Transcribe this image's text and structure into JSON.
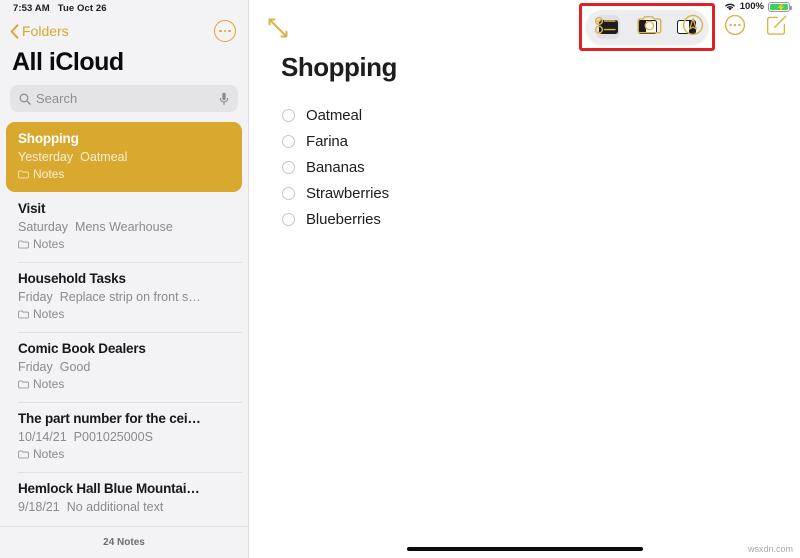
{
  "status_bar": {
    "time": "7:53 AM",
    "date": "Tue Oct 26",
    "wifi_icon": "wifi-icon",
    "battery_percent": "100%",
    "battery_state": "charging"
  },
  "sidebar": {
    "back_label": "Folders",
    "back_icon": "chevron-left-icon",
    "more_icon": "ellipsis-circle-icon",
    "title": "All iCloud",
    "search": {
      "placeholder": "Search",
      "search_icon": "magnifier-icon",
      "dictate_icon": "microphone-icon"
    },
    "notes": [
      {
        "title": "Shopping",
        "date": "Yesterday",
        "preview": "Oatmeal",
        "folder": "Notes",
        "selected": true
      },
      {
        "title": "Visit",
        "date": "Saturday",
        "preview": "Mens Wearhouse",
        "folder": "Notes",
        "selected": false
      },
      {
        "title": "Household Tasks",
        "date": "Friday",
        "preview": "Replace strip on front s…",
        "folder": "Notes",
        "selected": false
      },
      {
        "title": "Comic Book Dealers",
        "date": "Friday",
        "preview": "Good",
        "folder": "Notes",
        "selected": false
      },
      {
        "title": "The part number for the cei…",
        "date": "10/14/21",
        "preview": "P001025000S",
        "folder": "Notes",
        "selected": false
      },
      {
        "title": "Hemlock Hall Blue Mountai…",
        "date": "9/18/21",
        "preview": "No additional text",
        "folder": "",
        "selected": false
      }
    ],
    "footer_count": "24 Notes",
    "selected_color": "#d9a82e"
  },
  "detail": {
    "expand_icon": "expand-diagonal-icon",
    "multitask": {
      "highlighted": true,
      "highlight_color": "#e02029",
      "buttons": [
        {
          "label": "Full Screen",
          "icon": "fullscreen-icon",
          "active": true
        },
        {
          "label": "Split View",
          "icon": "splitview-icon",
          "active": false
        },
        {
          "label": "Slide Over",
          "icon": "slideover-icon",
          "active": false
        }
      ]
    },
    "toolbar_icons": [
      {
        "name": "checklist-icon",
        "label": "Checklist"
      },
      {
        "name": "camera-icon",
        "label": "Camera"
      },
      {
        "name": "markup-icon",
        "label": "Markup"
      },
      {
        "name": "more-icon",
        "label": "More"
      },
      {
        "name": "compose-icon",
        "label": "New Note"
      }
    ],
    "note_title": "Shopping",
    "checklist": [
      {
        "text": "Oatmeal",
        "checked": false
      },
      {
        "text": "Farina",
        "checked": false
      },
      {
        "text": "Bananas",
        "checked": false
      },
      {
        "text": "Strawberries",
        "checked": false
      },
      {
        "text": "Blueberries",
        "checked": false
      }
    ],
    "accent_color": "#d9a82e"
  },
  "watermark": "wsxdn.com"
}
